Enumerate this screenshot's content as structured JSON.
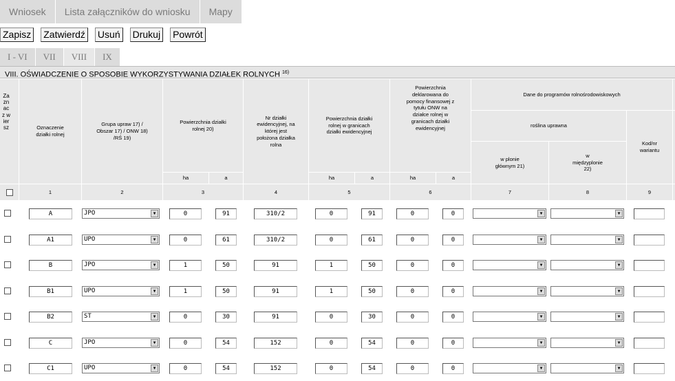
{
  "tabs": [
    "Wniosek",
    "Lista załączników do wniosku",
    "Mapy"
  ],
  "toolbar": {
    "zapisz": "Zapisz",
    "zatwierdz": "Zatwierdź",
    "usun": "Usuń",
    "drukuj": "Drukuj",
    "powrot": "Powrót"
  },
  "subtabs": [
    "I - VI",
    "VII",
    "VIII",
    "IX"
  ],
  "active_subtab": "VIII",
  "section_title": "VIII. OŚWIADCZENIE O SPOSOBIE WYKORZYSTYWANIA DZIAŁEK ROLNYCH",
  "section_title_sup": "16)",
  "headers": {
    "zaznacz": "Zaznacz wiersz",
    "col1": "Oznaczenie działki rolnej",
    "col2": "Grupa upraw 17) / Obszar 17) / ONW 18) /RŚ 19)",
    "col3": "Powierzchnia działki rolnej 20)",
    "col4": "Nr działki ewidencyjnej, na której jest położona działka rolna",
    "col5": "Powierzchnia działki rolnej w granicach działki ewidencyjnej",
    "col6": "Powierzchnia deklarowana do pomocy finansowej z tytułu ONW na działce rolnej w granicach działki ewidencyjnej",
    "rolno": "Dane do programów rolnośrodowiskowych",
    "roslina": "roślina uprawna",
    "plon_glowny": "w plonie głównym 21)",
    "miedzyplon": "w międzyplonie 22)",
    "kod_wariantu": "Kod/nr wariantu",
    "ha": "ha",
    "a": "a"
  },
  "col_numbers": [
    "1",
    "2",
    "3",
    "4",
    "5",
    "6",
    "7",
    "8",
    "9"
  ],
  "rows": [
    {
      "oznaczenie": "A",
      "grupa": "JPO",
      "pow_ha": "0",
      "pow_a": "91",
      "nr": "310/2",
      "pg_ha": "0",
      "pg_a": "91",
      "onw_ha": "0",
      "onw_a": "0",
      "plon": "",
      "miedzy": "",
      "kod": ""
    },
    {
      "oznaczenie": "A1",
      "grupa": "UPO",
      "pow_ha": "0",
      "pow_a": "61",
      "nr": "310/2",
      "pg_ha": "0",
      "pg_a": "61",
      "onw_ha": "0",
      "onw_a": "0",
      "plon": "",
      "miedzy": "",
      "kod": ""
    },
    {
      "oznaczenie": "B",
      "grupa": "JPO",
      "pow_ha": "1",
      "pow_a": "50",
      "nr": "91",
      "pg_ha": "1",
      "pg_a": "50",
      "onw_ha": "0",
      "onw_a": "0",
      "plon": "",
      "miedzy": "",
      "kod": ""
    },
    {
      "oznaczenie": "B1",
      "grupa": "UPO",
      "pow_ha": "1",
      "pow_a": "50",
      "nr": "91",
      "pg_ha": "1",
      "pg_a": "50",
      "onw_ha": "0",
      "onw_a": "0",
      "plon": "",
      "miedzy": "",
      "kod": ""
    },
    {
      "oznaczenie": "B2",
      "grupa": "ST",
      "pow_ha": "0",
      "pow_a": "30",
      "nr": "91",
      "pg_ha": "0",
      "pg_a": "30",
      "onw_ha": "0",
      "onw_a": "0",
      "plon": "",
      "miedzy": "",
      "kod": ""
    },
    {
      "oznaczenie": "C",
      "grupa": "JPO",
      "pow_ha": "0",
      "pow_a": "54",
      "nr": "152",
      "pg_ha": "0",
      "pg_a": "54",
      "onw_ha": "0",
      "onw_a": "0",
      "plon": "",
      "miedzy": "",
      "kod": ""
    },
    {
      "oznaczenie": "C1",
      "grupa": "UPO",
      "pow_ha": "0",
      "pow_a": "54",
      "nr": "152",
      "pg_ha": "0",
      "pg_a": "54",
      "onw_ha": "0",
      "onw_a": "0",
      "plon": "",
      "miedzy": "",
      "kod": ""
    }
  ],
  "icons": {
    "select_arrow": "dropdown-arrow-icon"
  }
}
